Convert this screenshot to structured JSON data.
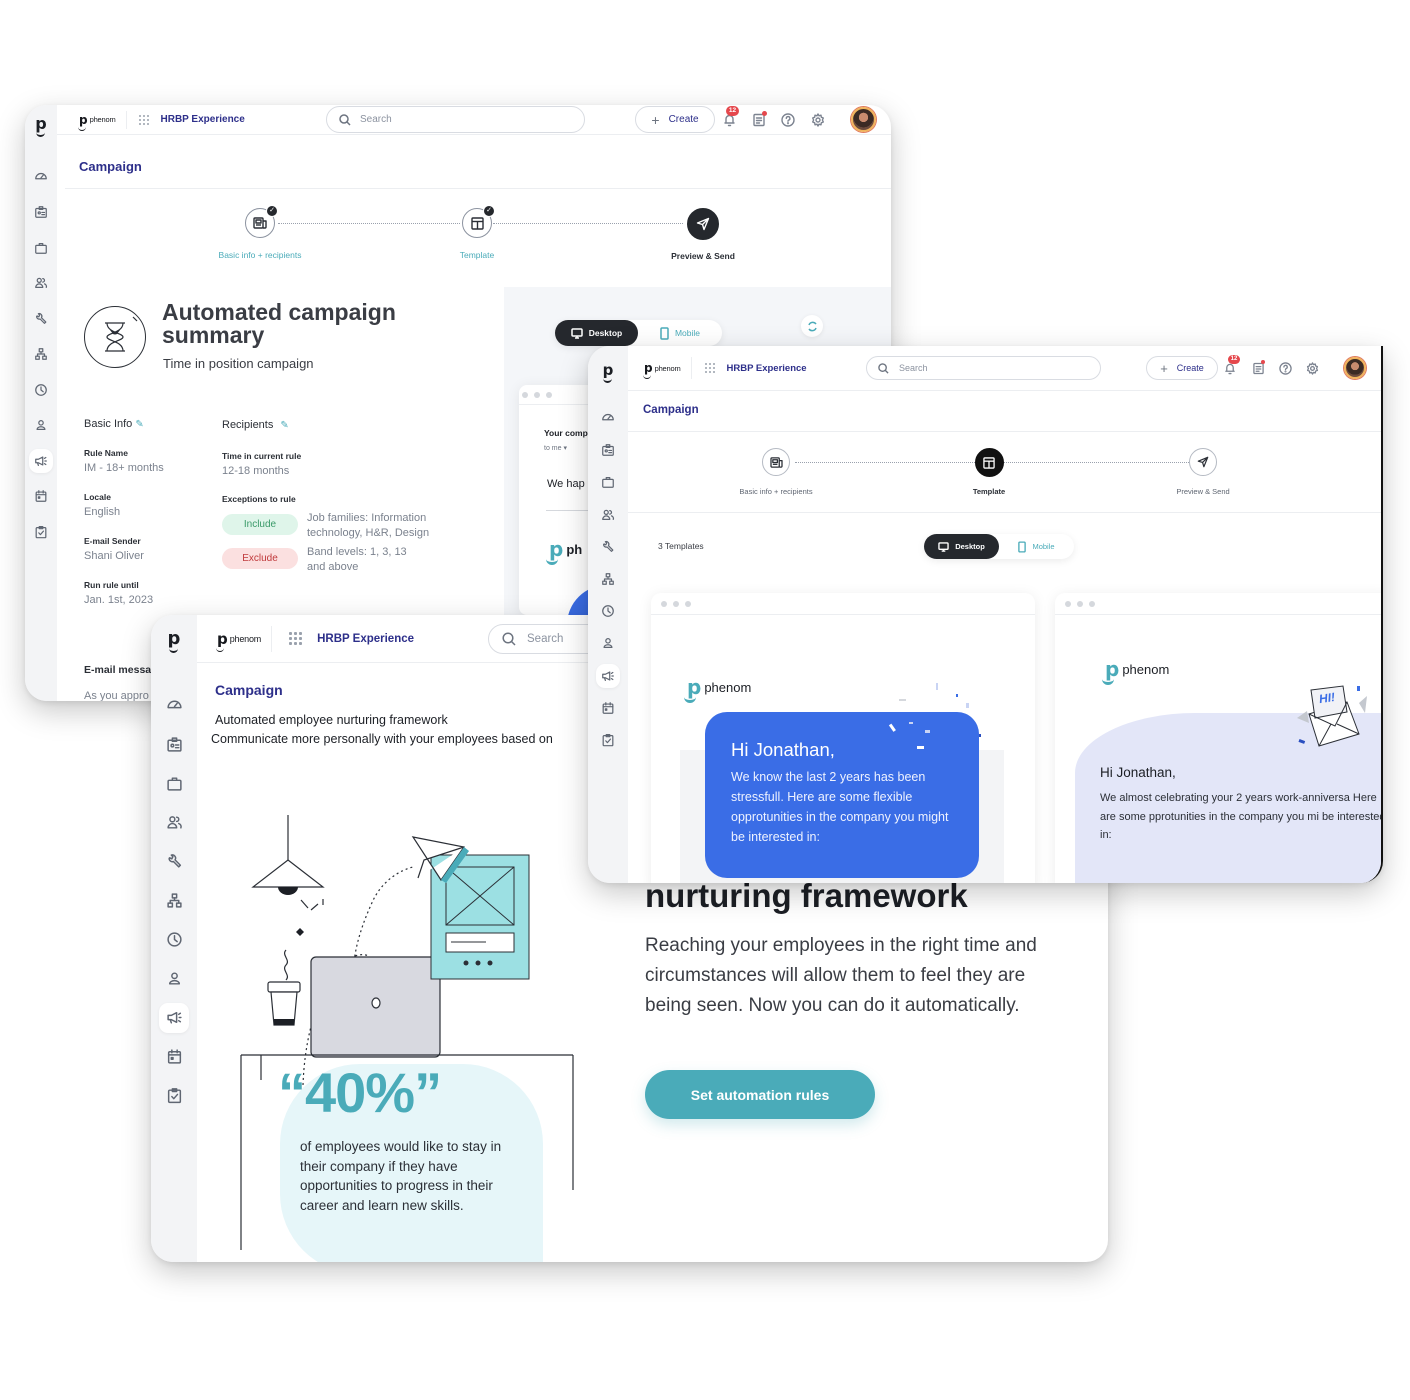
{
  "common": {
    "logo_letter": "p",
    "brand_name": "phenom",
    "app_name": "HRBP Experience",
    "search_placeholder": "Search",
    "create_label": "Create",
    "create_plus": "+",
    "notifications_count": "12",
    "page_title": "Campaign",
    "nav_icons": [
      "dashboard-icon",
      "id-card-icon",
      "briefcase-icon",
      "people-icon",
      "wrench-icon",
      "org-chart-icon",
      "clock-icon",
      "user-icon",
      "megaphone-icon",
      "calendar-icon",
      "clipboard-check-icon"
    ],
    "active_nav": "megaphone-icon",
    "steps": [
      {
        "label": "Basic info + recipients",
        "icon": "newspaper-icon"
      },
      {
        "label": "Template",
        "icon": "layout-icon"
      },
      {
        "label": "Preview & Send",
        "icon": "send-icon"
      }
    ],
    "desktop_label": "Desktop",
    "mobile_label": "Mobile"
  },
  "summary_window": {
    "title": "Automated campaign summary",
    "subtitle": "Time in position campaign",
    "basic_info": {
      "heading": "Basic Info",
      "fields": [
        {
          "label": "Rule Name",
          "value": "IM - 18+ months"
        },
        {
          "label": "Locale",
          "value": "English"
        },
        {
          "label": "E-mail Sender",
          "value": "Shani Oliver"
        },
        {
          "label": "Run rule until",
          "value": "Jan. 1st, 2023"
        }
      ],
      "email_message_label": "E-mail messa",
      "email_message_value": "As you appro"
    },
    "recipients": {
      "heading": "Recipients",
      "time_label": "Time in current rule",
      "time_value": "12-18 months",
      "exceptions_label": "Exceptions to rule",
      "include_label": "Include",
      "include_text": "Job families: Information technology, H&R, Design",
      "exclude_label": "Exclude",
      "exclude_text": "Band levels: 1, 3, 13 and above"
    },
    "preview": {
      "subject": "Your comp",
      "to": "to me",
      "greeting": "We hap",
      "brand": "ph"
    }
  },
  "template_window": {
    "count_label": "3 Templates",
    "cards": [
      {
        "brand": "phenom",
        "greeting": "Hi Jonathan,",
        "body": "We know the last 2 years has been stressfull. Here are some flexible opprotunities in the company you might be interested in:"
      },
      {
        "brand": "phenom",
        "badge": "HI!",
        "greeting": "Hi Jonathan,",
        "body": "We almost celebrating your 2 years work-anniversa Here are some pprotunities in the company you mi be interested in:"
      }
    ]
  },
  "framework_window": {
    "intro_title": "Automated employee nurturing framework",
    "intro_sub": "Communicate more personally with your employees based on",
    "heading_visible": "nurturing framework",
    "body": "Reaching your employees in the right time and circumstances will allow them to feel they are being seen. Now you can do it automatically.",
    "cta_label": "Set automation rules",
    "stat_value": "40%",
    "stat_open_quote": "“",
    "stat_close_quote": "”",
    "stat_text": "of employees would like to stay in their company if they have opportunities to progress in their career and learn new skills."
  },
  "colors": {
    "navy": "#2d2f8a",
    "teal": "#4aabb9",
    "blue_card": "#3a6de6",
    "include_bg": "#dff5ea",
    "include_fg": "#3a9a69",
    "exclude_bg": "#fbe0e0",
    "exclude_fg": "#c0393b"
  }
}
